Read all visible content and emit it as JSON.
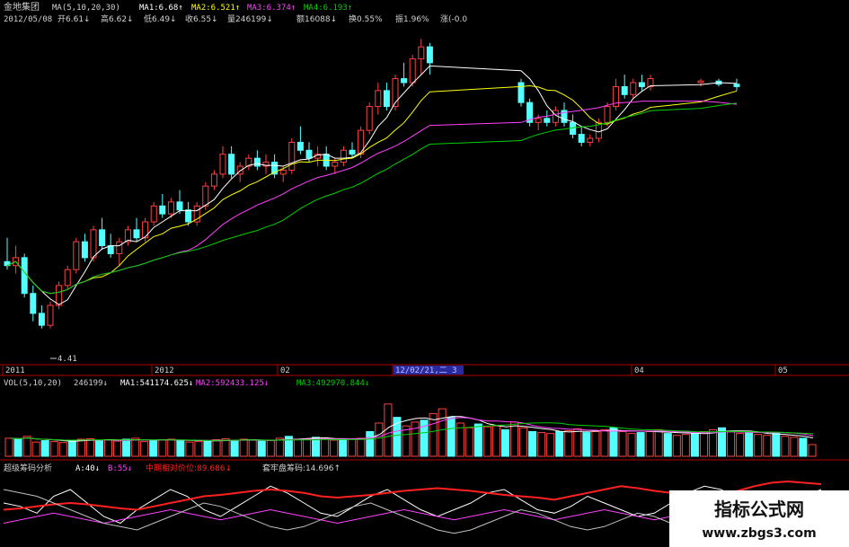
{
  "header": {
    "stock_name": "金地集团",
    "ma_label": "MA(5,10,20,30)",
    "ma1": "MA1:6.68↑",
    "ma2": "MA2:6.521↑",
    "ma3": "MA3:6.374↑",
    "ma4": "MA4:6.193↑",
    "date": "2012/05/08",
    "open": "开6.61↓",
    "high": "高6.62↓",
    "low": "低6.49↓",
    "close": "收6.55↓",
    "volume": "量246199↓",
    "amount": "额16088↓",
    "turnover": "换0.55%",
    "amplitude": "振1.96%",
    "change": "涨(-0.0"
  },
  "low_marker": "4.41",
  "time_axis": [
    {
      "label": "2011"
    },
    {
      "label": "2012"
    },
    {
      "label": "02"
    },
    {
      "label": "12/02/21,二 3",
      "highlight": true
    },
    {
      "label": "04"
    },
    {
      "label": "05"
    }
  ],
  "vol_header": {
    "label": "VOL(5,10,20)",
    "value": "246199↓",
    "ma1": "MA1:541174.625↓",
    "ma2": "MA2:592433.125↓",
    "ma3": "MA3:492970.844↓"
  },
  "ind_header": {
    "label": "超级筹码分析",
    "a": "A:40↓",
    "b": "B:55↓",
    "mid": "中期相对价位:89.686↓",
    "lock": "套牢盘筹码:14.696↑"
  },
  "watermark": {
    "title": "指标公式网",
    "url": "www.zbgs3.com"
  },
  "colors": {
    "up": "#ff4040",
    "down": "#54ffff",
    "ma1": "#ffffff",
    "ma2": "#ffff00",
    "ma3": "#ff40ff",
    "ma4": "#00d000",
    "grid": "#b00000",
    "text": "#d0d0d0"
  },
  "chart_data": [
    {
      "type": "candlestick",
      "title": "",
      "ylim": [
        4.0,
        8.2
      ],
      "candles": [
        [
          5.25,
          5.55,
          5.15,
          5.2
        ],
        [
          5.2,
          5.45,
          5.1,
          5.3
        ],
        [
          5.3,
          5.35,
          4.8,
          4.85
        ],
        [
          4.85,
          4.95,
          4.5,
          4.6
        ],
        [
          4.6,
          4.7,
          4.41,
          4.45
        ],
        [
          4.45,
          4.75,
          4.41,
          4.7
        ],
        [
          4.7,
          5.0,
          4.65,
          4.95
        ],
        [
          4.95,
          5.2,
          4.9,
          5.15
        ],
        [
          5.15,
          5.55,
          5.1,
          5.5
        ],
        [
          5.5,
          5.6,
          5.25,
          5.3
        ],
        [
          5.3,
          5.7,
          5.25,
          5.65
        ],
        [
          5.65,
          5.8,
          5.4,
          5.45
        ],
        [
          5.45,
          5.6,
          5.3,
          5.35
        ],
        [
          5.35,
          5.55,
          5.2,
          5.5
        ],
        [
          5.5,
          5.7,
          5.45,
          5.65
        ],
        [
          5.65,
          5.8,
          5.5,
          5.55
        ],
        [
          5.55,
          5.8,
          5.5,
          5.75
        ],
        [
          5.75,
          6.0,
          5.7,
          5.95
        ],
        [
          5.95,
          6.1,
          5.8,
          5.85
        ],
        [
          5.85,
          6.05,
          5.8,
          6.0
        ],
        [
          6.0,
          6.15,
          5.85,
          5.9
        ],
        [
          5.9,
          6.0,
          5.7,
          5.75
        ],
        [
          5.75,
          6.0,
          5.7,
          5.95
        ],
        [
          5.95,
          6.25,
          5.9,
          6.2
        ],
        [
          6.2,
          6.4,
          6.15,
          6.35
        ],
        [
          6.35,
          6.7,
          6.3,
          6.6
        ],
        [
          6.6,
          6.7,
          6.3,
          6.35
        ],
        [
          6.35,
          6.5,
          6.25,
          6.45
        ],
        [
          6.45,
          6.6,
          6.4,
          6.55
        ],
        [
          6.55,
          6.65,
          6.4,
          6.45
        ],
        [
          6.45,
          6.6,
          6.35,
          6.5
        ],
        [
          6.5,
          6.6,
          6.3,
          6.35
        ],
        [
          6.35,
          6.45,
          6.25,
          6.4
        ],
        [
          6.4,
          6.8,
          6.35,
          6.75
        ],
        [
          6.75,
          6.95,
          6.6,
          6.65
        ],
        [
          6.65,
          6.75,
          6.5,
          6.55
        ],
        [
          6.55,
          6.7,
          6.45,
          6.6
        ],
        [
          6.6,
          6.7,
          6.4,
          6.45
        ],
        [
          6.45,
          6.55,
          6.35,
          6.5
        ],
        [
          6.5,
          6.7,
          6.45,
          6.65
        ],
        [
          6.65,
          6.75,
          6.55,
          6.6
        ],
        [
          6.6,
          6.95,
          6.55,
          6.9
        ],
        [
          6.9,
          7.25,
          6.85,
          7.2
        ],
        [
          7.2,
          7.5,
          7.1,
          7.4
        ],
        [
          7.4,
          7.5,
          7.15,
          7.2
        ],
        [
          7.2,
          7.6,
          7.15,
          7.55
        ],
        [
          7.55,
          7.75,
          7.45,
          7.5
        ],
        [
          7.5,
          7.85,
          7.45,
          7.8
        ],
        [
          7.8,
          8.05,
          7.6,
          7.95
        ],
        [
          7.95,
          8.0,
          7.6,
          7.75
        ]
      ],
      "gap_start": 50,
      "candles2": [
        [
          7.5,
          7.55,
          7.2,
          7.25
        ],
        [
          7.25,
          7.3,
          6.95,
          7.0
        ],
        [
          7.0,
          7.1,
          6.9,
          7.05
        ],
        [
          7.05,
          7.15,
          6.95,
          7.0
        ],
        [
          7.0,
          7.2,
          6.95,
          7.15
        ],
        [
          7.15,
          7.25,
          6.95,
          7.0
        ],
        [
          7.0,
          7.1,
          6.8,
          6.85
        ],
        [
          6.85,
          6.95,
          6.7,
          6.75
        ],
        [
          6.75,
          6.85,
          6.7,
          6.8
        ],
        [
          6.8,
          7.05,
          6.75,
          7.0
        ],
        [
          7.0,
          7.25,
          6.95,
          7.2
        ],
        [
          7.2,
          7.55,
          7.15,
          7.45
        ],
        [
          7.45,
          7.6,
          7.3,
          7.35
        ],
        [
          7.35,
          7.55,
          7.3,
          7.5
        ],
        [
          7.5,
          7.6,
          7.4,
          7.45
        ],
        [
          7.45,
          7.6,
          7.4,
          7.55
        ]
      ],
      "tail": [
        [
          7.5,
          7.55,
          7.45,
          7.52
        ],
        [
          7.52,
          7.55,
          7.45,
          7.48
        ],
        [
          7.48,
          7.55,
          7.4,
          7.45
        ]
      ]
    },
    {
      "type": "bar",
      "title": "VOL(5,10,20)",
      "ylim": [
        0,
        1400000
      ],
      "values": [
        380,
        360,
        420,
        300,
        330,
        310,
        290,
        340,
        360,
        370,
        330,
        350,
        320,
        360,
        380,
        310,
        330,
        350,
        360,
        340,
        300,
        310,
        330,
        350,
        370,
        320,
        360,
        340,
        320,
        330,
        380,
        420,
        360,
        370,
        400,
        390,
        340,
        350,
        360,
        380,
        520,
        700,
        1100,
        820,
        640,
        720,
        760,
        900,
        1000,
        820,
        700,
        600,
        680,
        620,
        640,
        560,
        720,
        600,
        520,
        500,
        480,
        520,
        540,
        580,
        500,
        520,
        560,
        600,
        520,
        480,
        500,
        520,
        560,
        480,
        440,
        460,
        480,
        520,
        560,
        600,
        520,
        480,
        500,
        460,
        440,
        480,
        420,
        400,
        380,
        246
      ],
      "value_scale": 1000
    },
    {
      "type": "line",
      "title": "超级筹码分析",
      "ylim": [
        0,
        100
      ],
      "series": [
        {
          "name": "A",
          "color": "#ffffff",
          "values": [
            60,
            55,
            45,
            70,
            80,
            60,
            40,
            30,
            50,
            65,
            80,
            70,
            50,
            40,
            55,
            70,
            85,
            75,
            60,
            45,
            40,
            55,
            70,
            80,
            65,
            50,
            40,
            50,
            60,
            75,
            80,
            65,
            50,
            45,
            55,
            70,
            60,
            50,
            40,
            45,
            60,
            75,
            85,
            80,
            65,
            55,
            50,
            60,
            70,
            80
          ]
        },
        {
          "name": "B",
          "color": "#ff40ff",
          "values": [
            30,
            35,
            40,
            45,
            40,
            35,
            30,
            35,
            40,
            45,
            50,
            45,
            40,
            35,
            40,
            45,
            50,
            45,
            40,
            35,
            30,
            35,
            40,
            45,
            50,
            45,
            40,
            35,
            40,
            45,
            50,
            45,
            40,
            35,
            40,
            45,
            50,
            45,
            40,
            35,
            40,
            45,
            50,
            55,
            50,
            45,
            40,
            45,
            50,
            55
          ]
        },
        {
          "name": "中期相对价位",
          "color": "#ff2020",
          "values": [
            50,
            52,
            55,
            58,
            60,
            58,
            55,
            52,
            50,
            55,
            60,
            65,
            70,
            72,
            75,
            78,
            80,
            78,
            75,
            70,
            68,
            70,
            72,
            75,
            78,
            80,
            82,
            80,
            78,
            75,
            72,
            70,
            68,
            65,
            70,
            75,
            80,
            85,
            82,
            78,
            75,
            72,
            70,
            72,
            78,
            85,
            90,
            92,
            90,
            88
          ]
        },
        {
          "name": "套牢盘筹码",
          "color": "#c0c0c0",
          "values": [
            80,
            75,
            70,
            60,
            50,
            40,
            30,
            25,
            20,
            30,
            40,
            50,
            60,
            55,
            45,
            35,
            25,
            20,
            25,
            35,
            45,
            55,
            60,
            50,
            40,
            30,
            20,
            15,
            20,
            30,
            40,
            50,
            45,
            35,
            25,
            20,
            25,
            35,
            45,
            40,
            30,
            20,
            15,
            20,
            25,
            30,
            20,
            15,
            12,
            15
          ]
        }
      ]
    }
  ]
}
